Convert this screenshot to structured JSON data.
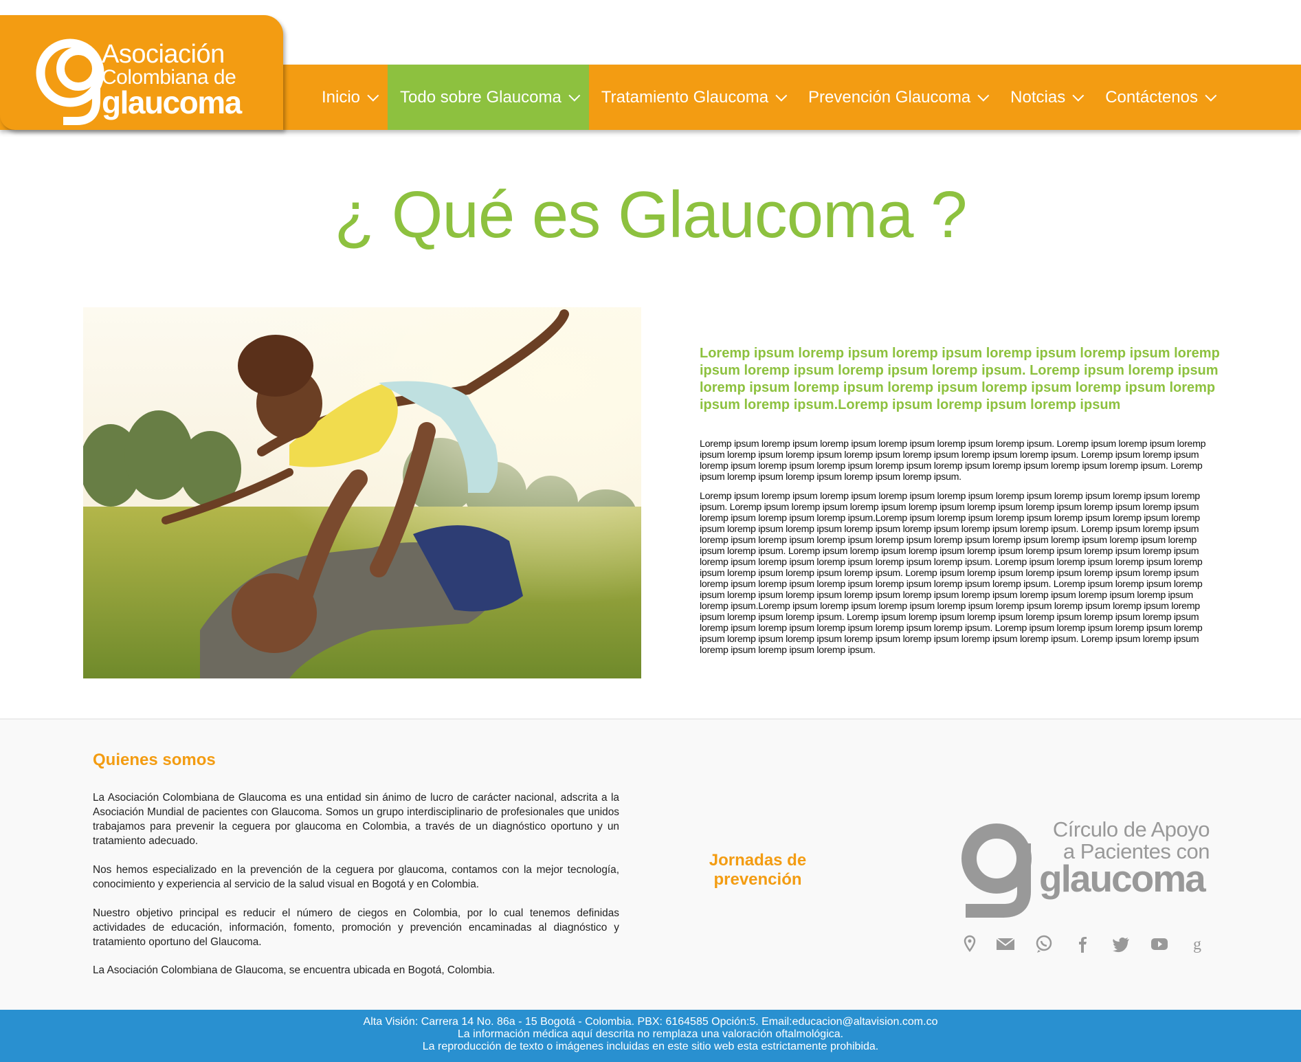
{
  "header": {
    "logo": {
      "line1": "Asociación",
      "line2": "Colombiana de",
      "line3": "glaucoma"
    },
    "menu": [
      {
        "label": "Inicio",
        "active": false
      },
      {
        "label": "Todo sobre Glaucoma",
        "active": true
      },
      {
        "label": "Tratamiento Glaucoma",
        "active": false
      },
      {
        "label": "Prevención Glaucoma",
        "active": false
      },
      {
        "label": "Notcias",
        "active": false
      },
      {
        "label": "Contáctenos",
        "active": false
      }
    ]
  },
  "main": {
    "title": "¿ Qué es Glaucoma ?",
    "lead": "Loremp ipsum loremp ipsum loremp ipsum loremp ipsum loremp ipsum loremp ipsum loremp ipsum loremp ipsum loremp ipsum. Loremp ipsum loremp ipsum loremp ipsum loremp ipsum loremp ipsum loremp ipsum loremp ipsum loremp ipsum loremp ipsum.Loremp ipsum loremp ipsum loremp ipsum",
    "paragraph1": "Loremp ipsum loremp ipsum loremp ipsum loremp ipsum loremp ipsum loremp ipsum. Loremp ipsum loremp ipsum loremp ipsum loremp ipsum loremp ipsum loremp ipsum loremp ipsum loremp ipsum loremp ipsum. Loremp ipsum loremp ipsum loremp ipsum loremp ipsum loremp ipsum loremp ipsum loremp ipsum loremp ipsum loremp ipsum loremp ipsum. Loremp ipsum loremp ipsum loremp ipsum loremp ipsum loremp ipsum.",
    "paragraph2": "Loremp ipsum loremp ipsum loremp ipsum loremp ipsum loremp ipsum loremp ipsum loremp ipsum loremp ipsum loremp ipsum. Loremp ipsum loremp ipsum loremp ipsum loremp ipsum loremp ipsum loremp ipsum loremp ipsum loremp ipsum loremp ipsum loremp ipsum loremp ipsum.Loremp ipsum loremp ipsum loremp ipsum loremp ipsum loremp ipsum loremp ipsum loremp ipsum loremp ipsum loremp ipsum loremp ipsum loremp ipsum loremp ipsum. Loremp ipsum loremp ipsum loremp ipsum loremp ipsum loremp ipsum loremp ipsum loremp ipsum loremp ipsum loremp ipsum loremp ipsum loremp ipsum loremp ipsum. Loremp ipsum loremp ipsum loremp ipsum loremp ipsum loremp ipsum loremp ipsum loremp ipsum loremp ipsum loremp ipsum loremp ipsum loremp ipsum loremp ipsum. Loremp ipsum loremp ipsum loremp ipsum loremp ipsum loremp ipsum loremp ipsum loremp ipsum. Loremp ipsum loremp ipsum loremp ipsum loremp ipsum loremp ipsum loremp ipsum loremp ipsum loremp ipsum loremp ipsum loremp ipsum loremp ipsum. Loremp ipsum loremp ipsum loremp ipsum loremp ipsum loremp ipsum loremp ipsum loremp ipsum loremp ipsum loremp ipsum loremp ipsum loremp ipsum loremp ipsum.Loremp ipsum loremp ipsum loremp ipsum loremp ipsum loremp ipsum loremp ipsum loremp ipsum loremp ipsum loremp ipsum loremp ipsum. Loremp ipsum loremp ipsum loremp ipsum loremp ipsum loremp ipsum loremp ipsum loremp ipsum loremp ipsum loremp ipsum loremp ipsum loremp ipsum. Loremp ipsum loremp ipsum loremp ipsum loremp ipsum loremp ipsum loremp ipsum loremp ipsum loremp ipsum loremp ipsum loremp ipsum. Loremp ipsum loremp ipsum loremp ipsum loremp ipsum loremp ipsum."
  },
  "footer": {
    "about_title": "Quienes somos",
    "about_p1": "La Asociación Colombiana de Glaucoma es una entidad sin ánimo de lucro de carácter nacional, adscrita a la Asociación Mundial de pacientes con Glaucoma.  Somos un grupo interdisciplinario de profesionales que unidos trabajamos para prevenir la ceguera por glaucoma en Colombia, a través de un diagnóstico oportuno y un tratamiento adecuado.",
    "about_p2": "Nos hemos especializado en la prevención de la ceguera por glaucoma, contamos con la mejor tecnología, conocimiento y experiencia al servicio de la salud visual en Bogotá y en Colombia.",
    "about_p3": "Nuestro objetivo principal es reducir el número de ciegos en Colombia, por lo cual tenemos definidas actividades de educación, información, fomento, promoción y prevención encaminadas al diagnóstico y tratamiento oportuno del Glaucoma.",
    "about_p4": "La Asociación Colombiana de Glaucoma, se encuentra ubicada en Bogotá, Colombia.",
    "jornadas": "Jornadas de prevención",
    "circle_logo": {
      "line1": "Círculo de Apoyo",
      "line2": "a Pacientes con",
      "line3": "glaucoma"
    },
    "social_icons": [
      "location-icon",
      "mail-icon",
      "whatsapp-icon",
      "facebook-icon",
      "twitter-icon",
      "youtube-icon",
      "google-plus-icon"
    ]
  },
  "bottom_bar": {
    "line1": "Alta Visión: Carrera 14 No. 86a - 15 Bogotá - Colombia. PBX: 6164585 Opción:5. Email:educacion@altavision.com.co",
    "line2": "La información médica aquí descrita no remplaza una valoración oftalmológica.",
    "line3": "La reproducción de texto o imágenes incluidas en este sitio web esta estrictamente prohibida."
  },
  "colors": {
    "orange": "#f39c12",
    "green": "#8dc13f",
    "blue": "#2990d0",
    "grey_logo": "#999999"
  }
}
